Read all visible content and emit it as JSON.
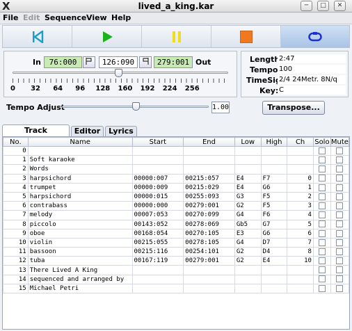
{
  "window": {
    "title": "lived_a_king.kar"
  },
  "menu": {
    "file": "File",
    "edit": "Edit",
    "sequence": "Sequence",
    "view": "View",
    "help": "Help"
  },
  "transport": {
    "buttons": [
      "rewind-icon",
      "play-icon",
      "pause-icon",
      "stop-icon",
      "loop-icon"
    ],
    "colors": {
      "rewind": "#1aa0c8",
      "play": "#1ab41a",
      "pause": "#f2dc1e",
      "stop": "#f07820",
      "loop": "#1c2fd6"
    }
  },
  "position": {
    "in_label": "In",
    "in_value": "76:000",
    "current": "126:090",
    "out_value": "279:001",
    "out_label": "Out",
    "slider_fraction": 0.49,
    "ticks": [
      "0",
      "32",
      "64",
      "96",
      "128",
      "160",
      "192",
      "224",
      "256"
    ]
  },
  "info": {
    "length_label": "Length:",
    "length": "2:47",
    "tempo_label": "Tempo:",
    "tempo": "100",
    "timesig_label": "TimeSig:",
    "timesig": "2/4 24Metr. 8N/q",
    "key_label": "Key:",
    "key": "C"
  },
  "tempo_adjust": {
    "label": "Tempo Adjust",
    "value": "1.00",
    "slider_fraction": 0.5
  },
  "transpose_button": "Transpose...",
  "tabs": [
    "Track Summary",
    "Editor",
    "Lyrics"
  ],
  "table": {
    "columns": [
      "No.",
      "Name",
      "Start",
      "End",
      "Low",
      "High",
      "Ch",
      "Solo",
      "Mute"
    ],
    "rows": [
      {
        "no": "0",
        "name": "",
        "start": "",
        "end": "",
        "low": "",
        "high": "",
        "ch": ""
      },
      {
        "no": "1",
        "name": "Soft karaoke",
        "start": "",
        "end": "",
        "low": "",
        "high": "",
        "ch": ""
      },
      {
        "no": "2",
        "name": "Words",
        "start": "",
        "end": "",
        "low": "",
        "high": "",
        "ch": ""
      },
      {
        "no": "3",
        "name": "harpsichord",
        "start": "00000:007",
        "end": "00215:057",
        "low": "E4",
        "high": "F7",
        "ch": "0"
      },
      {
        "no": "4",
        "name": "trumpet",
        "start": "00000:009",
        "end": "00215:029",
        "low": "E4",
        "high": "G6",
        "ch": "1"
      },
      {
        "no": "5",
        "name": "harpsichord",
        "start": "00000:015",
        "end": "00255:093",
        "low": "G3",
        "high": "F5",
        "ch": "2"
      },
      {
        "no": "6",
        "name": "contrabass",
        "start": "00000:000",
        "end": "00279:001",
        "low": "G2",
        "high": "F5",
        "ch": "3"
      },
      {
        "no": "7",
        "name": "melody",
        "start": "00007:053",
        "end": "00270:099",
        "low": "G4",
        "high": "F6",
        "ch": "4"
      },
      {
        "no": "8",
        "name": "piccolo",
        "start": "00143:052",
        "end": "00278:069",
        "low": "Gb5",
        "high": "G7",
        "ch": "5"
      },
      {
        "no": "9",
        "name": "oboe",
        "start": "00168:054",
        "end": "00270:105",
        "low": "E3",
        "high": "G6",
        "ch": "6"
      },
      {
        "no": "10",
        "name": "violin",
        "start": "00215:055",
        "end": "00278:105",
        "low": "G4",
        "high": "D7",
        "ch": "7"
      },
      {
        "no": "11",
        "name": "bassoon",
        "start": "00215:116",
        "end": "00254:101",
        "low": "G2",
        "high": "D4",
        "ch": "8"
      },
      {
        "no": "12",
        "name": "tuba",
        "start": "00167:119",
        "end": "00279:001",
        "low": "G2",
        "high": "E4",
        "ch": "10"
      },
      {
        "no": "13",
        "name": "There Lived A King",
        "start": "",
        "end": "",
        "low": "",
        "high": "",
        "ch": ""
      },
      {
        "no": "14",
        "name": "sequenced and arranged by",
        "start": "",
        "end": "",
        "low": "",
        "high": "",
        "ch": ""
      },
      {
        "no": "15",
        "name": "Michael Petri",
        "start": "",
        "end": "",
        "low": "",
        "high": "",
        "ch": ""
      }
    ]
  }
}
